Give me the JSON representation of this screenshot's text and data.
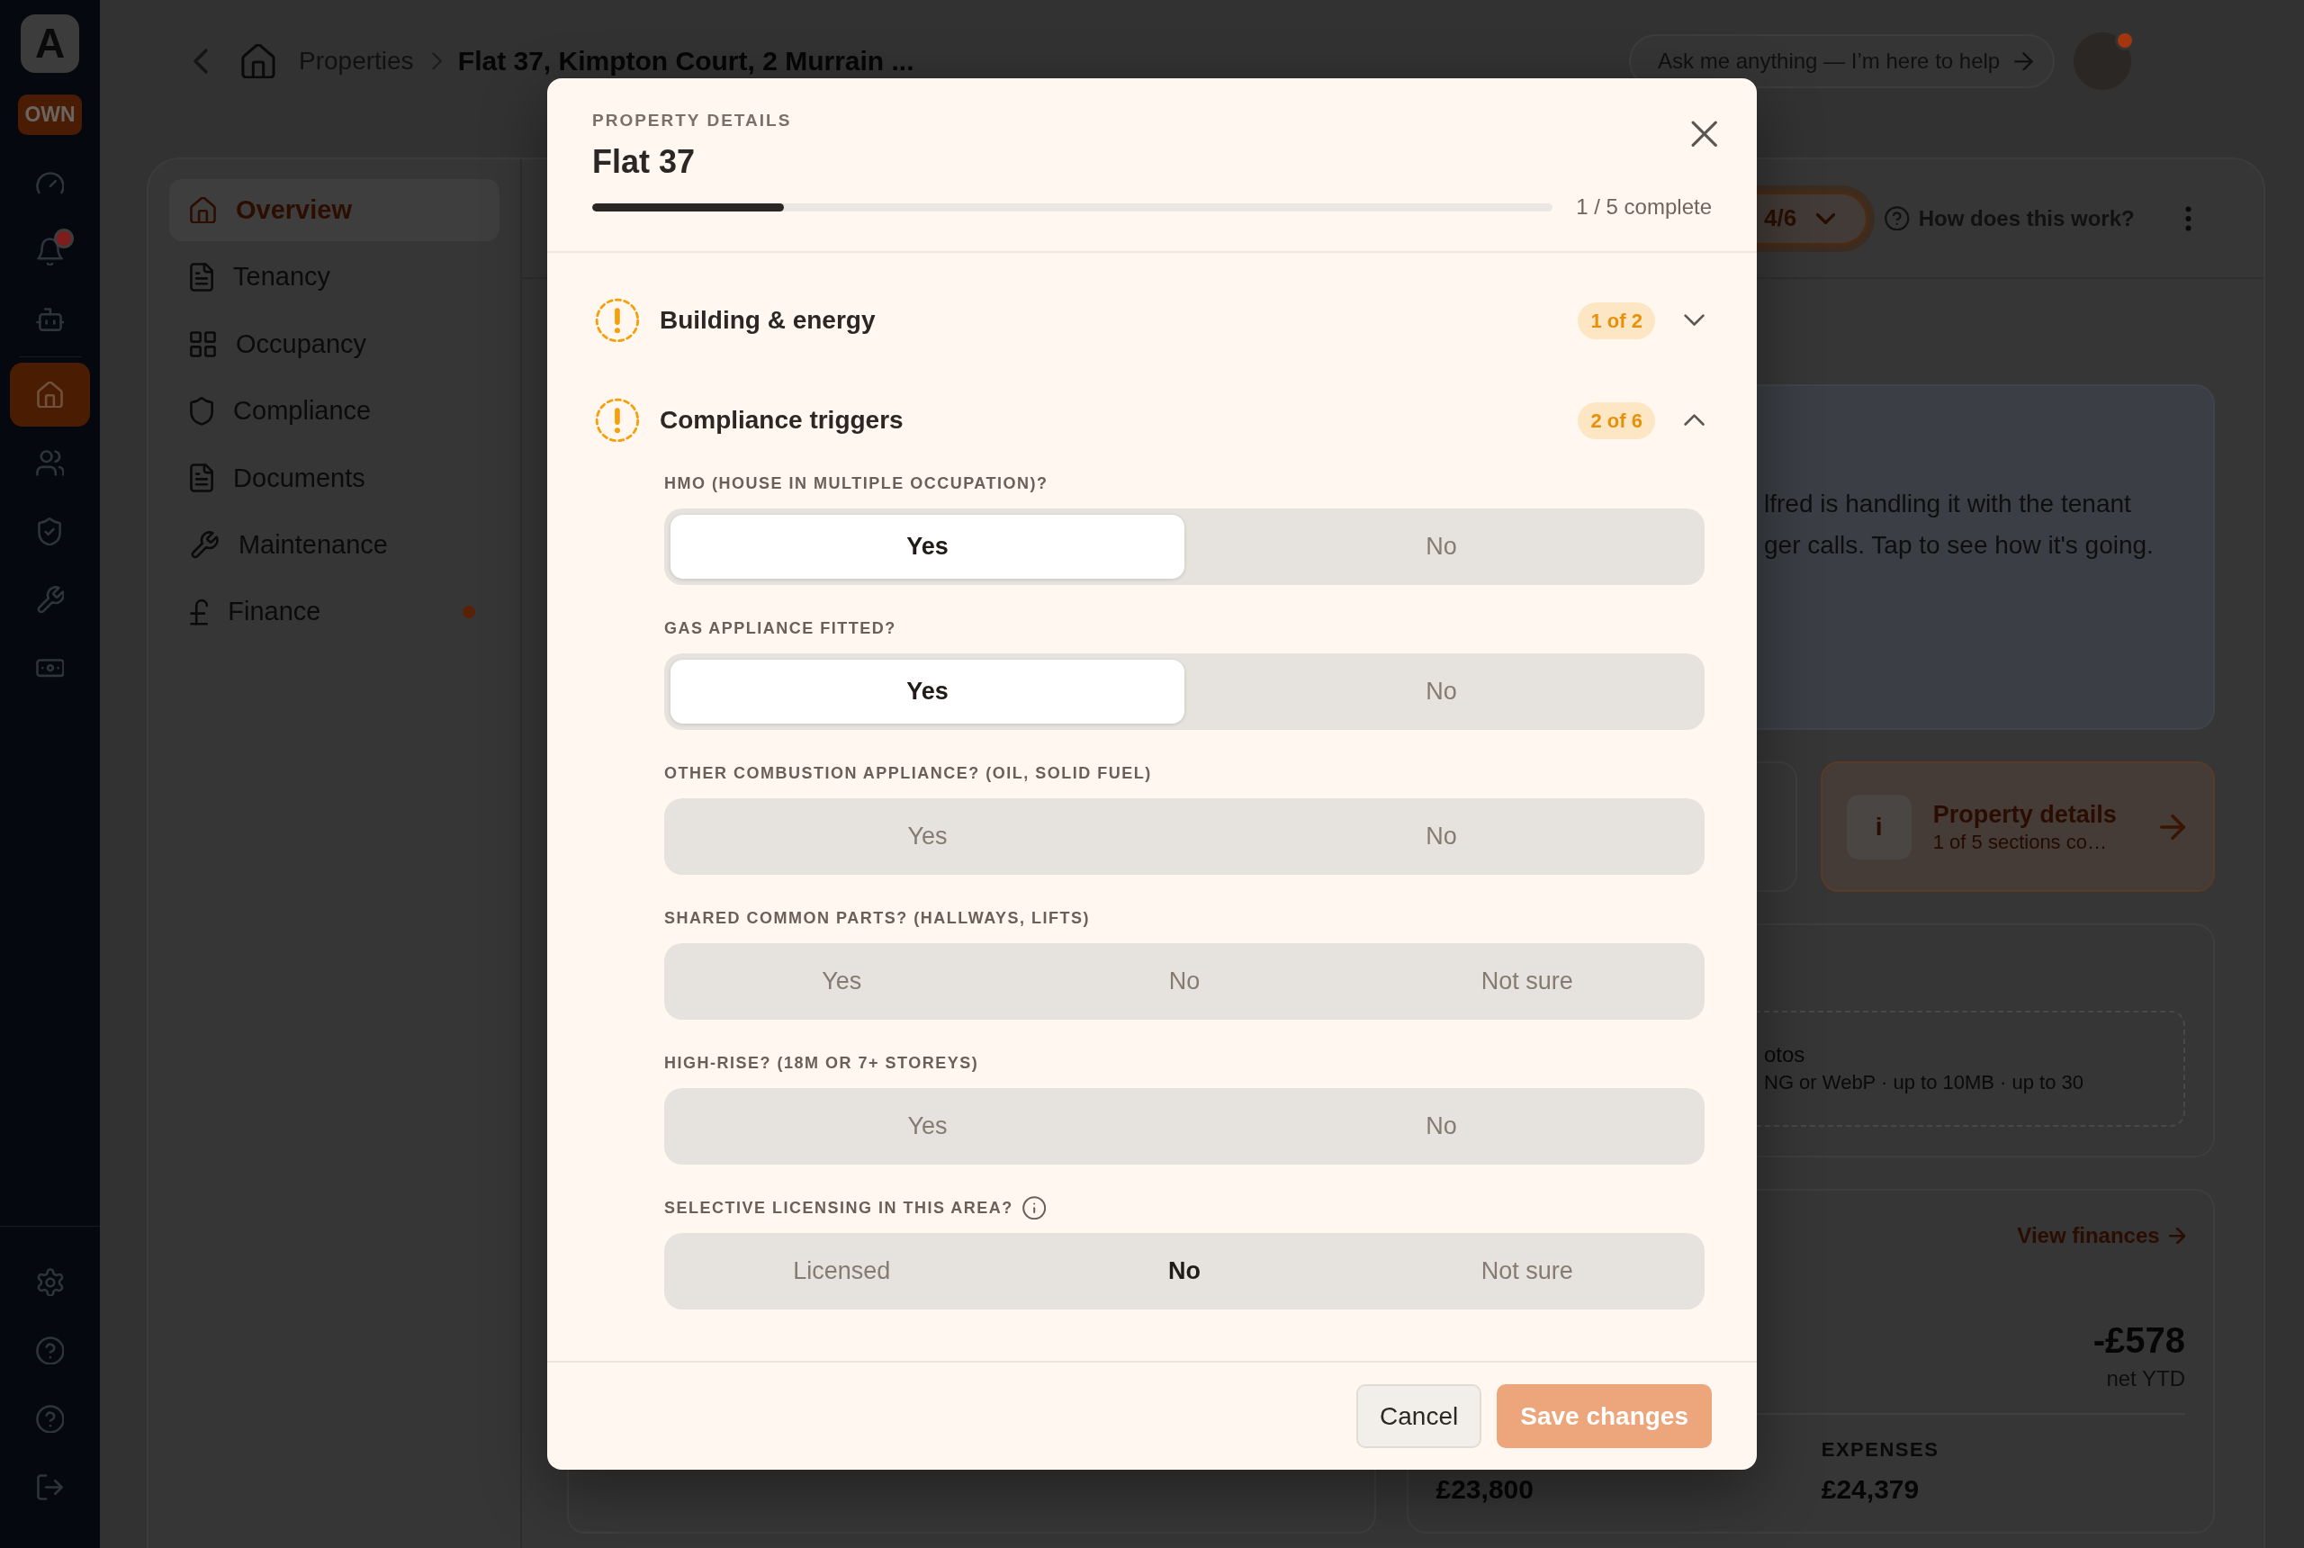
{
  "rail": {
    "logo": "A",
    "plan": "OWN",
    "items": [
      {
        "selected": false,
        "alert": false
      },
      {
        "selected": false,
        "alert": true
      },
      {
        "selected": false,
        "alert": false
      },
      {
        "selected": true,
        "alert": false
      },
      {
        "selected": false,
        "alert": false
      },
      {
        "selected": false,
        "alert": false
      },
      {
        "selected": false,
        "alert": false
      },
      {
        "selected": false,
        "alert": false
      }
    ],
    "footer_items": [
      {
        "selected": false
      },
      {
        "selected": false
      },
      {
        "selected": false
      },
      {
        "selected": false
      }
    ]
  },
  "topbar": {
    "breadcrumbs": [
      {
        "label": "Properties",
        "current": false
      },
      {
        "label": "Flat 37, Kimpton Court, 2 Murrain ...",
        "current": true
      }
    ],
    "assistant": {
      "label": "Ask me anything — I’m here to help"
    },
    "avatar": {
      "notification": true
    }
  },
  "property_nav": {
    "items": [
      {
        "label": "Overview",
        "selected": true,
        "alert": false
      },
      {
        "label": "Tenancy",
        "selected": false,
        "alert": false
      },
      {
        "label": "Occupancy",
        "selected": false,
        "alert": false
      },
      {
        "label": "Compliance",
        "selected": false,
        "alert": false
      },
      {
        "label": "Documents",
        "selected": false,
        "alert": false
      },
      {
        "label": "Maintenance",
        "selected": false,
        "alert": false
      },
      {
        "label": "Finance",
        "selected": false,
        "alert": true
      }
    ]
  },
  "panel_header": {
    "setup_progress": "4/6",
    "help": "How does this work?"
  },
  "cards": {
    "alert_lines": [
      "lfred is handling it with the tenant",
      "ger calls. Tap to see how it's going."
    ],
    "property_details": {
      "icon_letter": "i",
      "title": "Property details",
      "subtitle": "1 of 5 sections co…"
    },
    "photos": {
      "title": "otos",
      "hint": "NG or WebP · up to 10MB · up to 30"
    },
    "finance": {
      "link": "View finances",
      "net_value": "-£578",
      "net_label": "net YTD",
      "income_value": "£23,800",
      "expenses_label": "EXPENSES",
      "expenses_value": "£24,379"
    }
  },
  "modal": {
    "eyebrow": "PROPERTY DETAILS",
    "title": "Flat 37",
    "progress": {
      "level": 0.2,
      "label": "1 / 5 complete"
    },
    "sections": [
      {
        "title": "Building & energy",
        "count": "1 of 2",
        "complete": false,
        "expanded": false
      },
      {
        "title": "Compliance triggers",
        "count": "2 of 6",
        "complete": false,
        "expanded": true,
        "questions": [
          {
            "label": "HMO (HOUSE IN MULTIPLE OCCUPATION)?",
            "info": false,
            "options": [
              {
                "label": "Yes",
                "selected": true,
                "emphasized": true
              },
              {
                "label": "No",
                "selected": false,
                "emphasized": false
              }
            ]
          },
          {
            "label": "GAS APPLIANCE FITTED?",
            "info": false,
            "options": [
              {
                "label": "Yes",
                "selected": true,
                "emphasized": true
              },
              {
                "label": "No",
                "selected": false,
                "emphasized": false
              }
            ]
          },
          {
            "label": "OTHER COMBUSTION APPLIANCE? (OIL, SOLID FUEL)",
            "info": false,
            "options": [
              {
                "label": "Yes",
                "selected": false,
                "emphasized": false
              },
              {
                "label": "No",
                "selected": false,
                "emphasized": false
              }
            ]
          },
          {
            "label": "SHARED COMMON PARTS? (HALLWAYS, LIFTS)",
            "info": false,
            "options": [
              {
                "label": "Yes",
                "selected": false,
                "emphasized": false
              },
              {
                "label": "No",
                "selected": false,
                "emphasized": false
              },
              {
                "label": "Not sure",
                "selected": false,
                "emphasized": false
              }
            ]
          },
          {
            "label": "HIGH-RISE? (18M OR 7+ STOREYS)",
            "info": false,
            "options": [
              {
                "label": "Yes",
                "selected": false,
                "emphasized": false
              },
              {
                "label": "No",
                "selected": false,
                "emphasized": false
              }
            ]
          },
          {
            "label": "SELECTIVE LICENSING IN THIS AREA?",
            "info": true,
            "options": [
              {
                "label": "Licensed",
                "selected": false,
                "emphasized": false
              },
              {
                "label": "No",
                "selected": false,
                "emphasized": true
              },
              {
                "label": "Not sure",
                "selected": false,
                "emphasized": false
              }
            ]
          }
        ]
      }
    ],
    "buttons": [
      {
        "label": "Cancel",
        "kind": "secondary",
        "disabled": false
      },
      {
        "label": "Save changes",
        "kind": "primary",
        "disabled": true
      }
    ]
  }
}
